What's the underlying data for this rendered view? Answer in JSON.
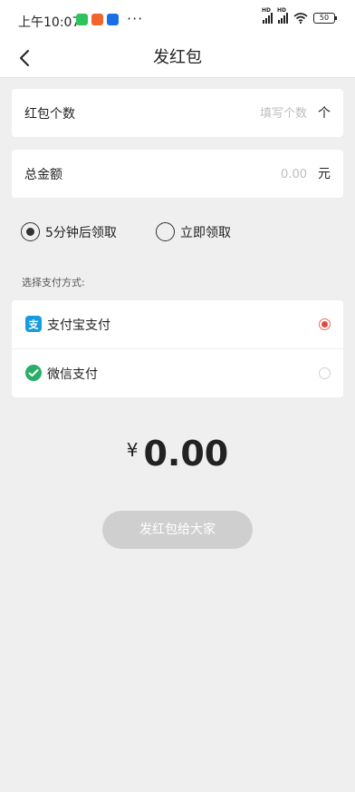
{
  "status_bar": {
    "time": "上午10:07",
    "more": "···",
    "battery": "50"
  },
  "nav": {
    "title": "发红包",
    "back_icon": "chevron-left-icon"
  },
  "count_row": {
    "label": "红包个数",
    "placeholder": "填写个数",
    "unit": "个"
  },
  "amount_row": {
    "label": "总金额",
    "placeholder": "0.00",
    "unit": "元"
  },
  "claim_options": [
    {
      "label": "5分钟后领取",
      "selected": true
    },
    {
      "label": "立即领取",
      "selected": false
    }
  ],
  "payment": {
    "section_label": "选择支付方式:",
    "methods": [
      {
        "label": "支付宝支付",
        "icon": "alipay-icon",
        "color": "#1a9bde",
        "selected": true
      },
      {
        "label": "微信支付",
        "icon": "wechat-pay-icon",
        "color": "#2aae67",
        "selected": false
      }
    ]
  },
  "total": {
    "currency": "¥",
    "value": "0.00"
  },
  "send_button": {
    "label": "发红包给大家",
    "enabled": false
  },
  "colors": {
    "background": "#efefef",
    "selected_radio": "#e04b3c",
    "disabled_button": "#cfcfcf"
  }
}
